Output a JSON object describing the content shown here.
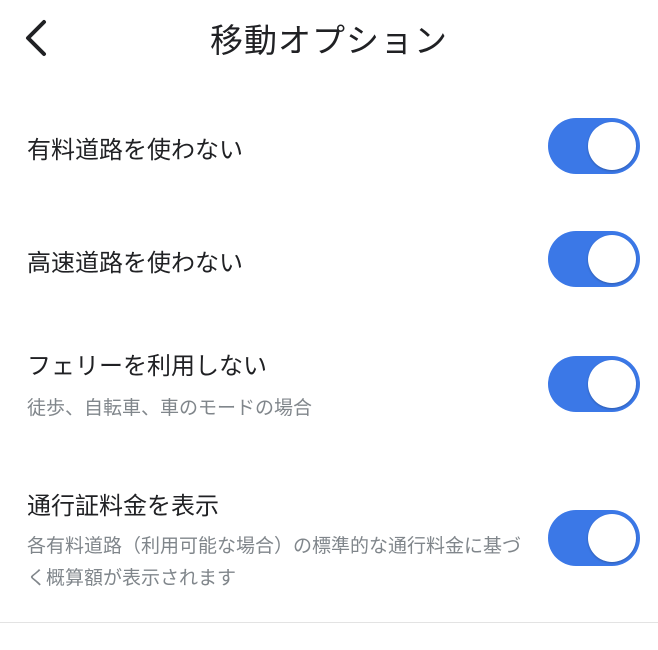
{
  "header": {
    "title": "移動オプション",
    "back_icon": "chevron-left-icon"
  },
  "options": [
    {
      "label": "有料道路を使わない",
      "description": "",
      "enabled": true
    },
    {
      "label": "高速道路を使わない",
      "description": "",
      "enabled": true
    },
    {
      "label": "フェリーを利用しない",
      "description": "徒歩、自転車、車のモードの場合",
      "enabled": true
    },
    {
      "label": "通行証料金を表示",
      "description": "各有料道路（利用可能な場合）の標準的な通行料金に基づく概算額が表示されます",
      "enabled": true
    }
  ],
  "colors": {
    "toggle_on": "#3b78e7",
    "text_primary": "#202124",
    "text_secondary": "#80868b"
  }
}
